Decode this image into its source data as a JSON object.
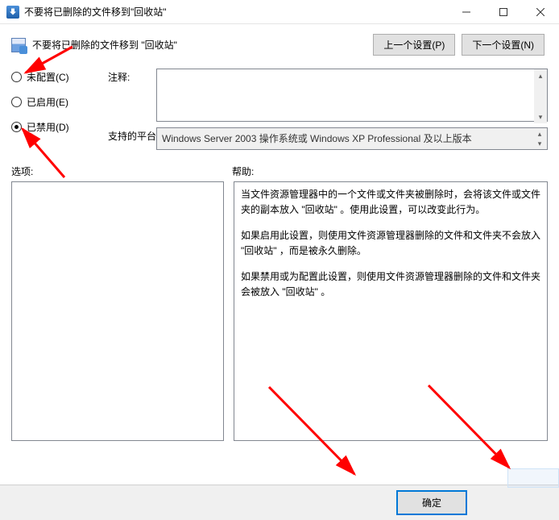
{
  "titlebar": {
    "title": "不要将已删除的文件移到\"回收站\""
  },
  "subheader": {
    "title": "不要将已删除的文件移到 \"回收站\"",
    "prev_btn": "上一个设置(P)",
    "next_btn": "下一个设置(N)"
  },
  "radios": {
    "not_configured": "未配置(C)",
    "enabled": "已启用(E)",
    "disabled": "已禁用(D)",
    "selected": "disabled"
  },
  "labels": {
    "notes": "注释:",
    "platform": "支持的平台:",
    "options": "选项:",
    "help": "帮助:"
  },
  "fields": {
    "notes_value": "",
    "platform_value": "Windows Server 2003 操作系统或 Windows XP Professional 及以上版本"
  },
  "help_text": {
    "p1": "当文件资源管理器中的一个文件或文件夹被删除时，会将该文件或文件夹的副本放入 \"回收站\" 。使用此设置，可以改变此行为。",
    "p2": "如果启用此设置，则使用文件资源管理器删除的文件和文件夹不会放入 \"回收站\" ，而是被永久删除。",
    "p3": "如果禁用或为配置此设置，则使用文件资源管理器删除的文件和文件夹会被放入 \"回收站\" 。"
  },
  "actions": {
    "ok": "确定"
  }
}
